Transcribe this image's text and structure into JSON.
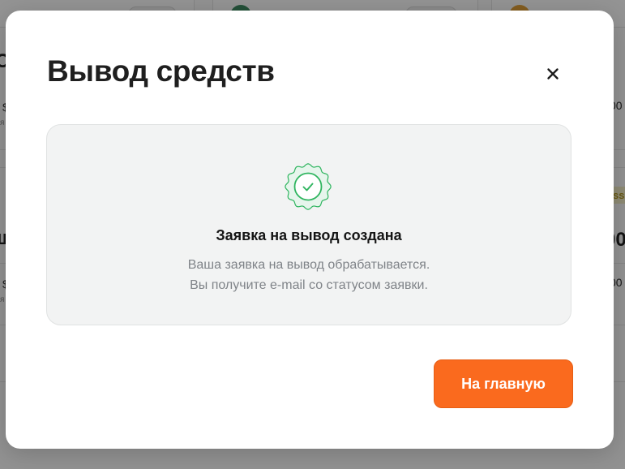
{
  "background": {
    "fragments": {
      "left_big": "O",
      "left_small_1": "$",
      "left_small_2": "я",
      "left_big_2": "ш",
      "left_small_3": "$",
      "left_small_4": "я",
      "right_num_1": "00",
      "right_badge": "ss",
      "right_big": "00",
      "right_num_2": "00"
    }
  },
  "modal": {
    "title": "Вывод средств",
    "close_icon": "close-icon",
    "status": {
      "icon": "verified-check-seal-icon",
      "icon_color": "#2fb55f",
      "title": "Заявка на вывод создана",
      "description_line1": "Ваша заявка на вывод обрабатывается.",
      "description_line2": "Вы получите e-mail со статусом заявки."
    },
    "home_button": "На главную",
    "accent_color": "#fa6a1e"
  }
}
